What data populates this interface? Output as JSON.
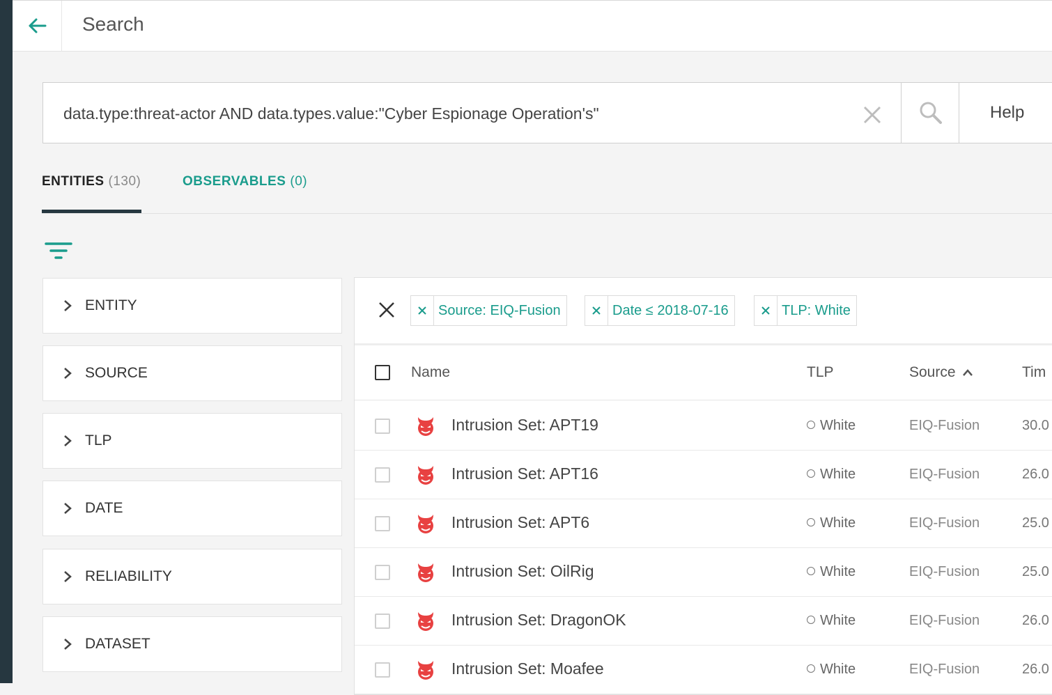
{
  "header": {
    "title": "Search"
  },
  "search": {
    "query": "data.type:threat-actor AND data.types.value:\"Cyber Espionage Operation's\"",
    "help_label": "Help"
  },
  "tabs": [
    {
      "label": "ENTITIES",
      "count": "(130)",
      "active": true
    },
    {
      "label": "OBSERVABLES",
      "count": "(0)",
      "active": false
    }
  ],
  "facets": [
    "ENTITY",
    "SOURCE",
    "TLP",
    "DATE",
    "RELIABILITY",
    "DATASET"
  ],
  "active_filters": [
    "Source: EIQ-Fusion",
    "Date ≤ 2018-07-16",
    "TLP: White"
  ],
  "table": {
    "columns": {
      "name": "Name",
      "tlp": "TLP",
      "source": "Source",
      "time": "Tim"
    },
    "sort": {
      "column": "source",
      "direction": "asc"
    },
    "rows": [
      {
        "name": "Intrusion Set: APT19",
        "tlp": "White",
        "source": "EIQ-Fusion",
        "time": "30.0"
      },
      {
        "name": "Intrusion Set: APT16",
        "tlp": "White",
        "source": "EIQ-Fusion",
        "time": "26.0"
      },
      {
        "name": "Intrusion Set: APT6",
        "tlp": "White",
        "source": "EIQ-Fusion",
        "time": "25.0"
      },
      {
        "name": "Intrusion Set: OilRig",
        "tlp": "White",
        "source": "EIQ-Fusion",
        "time": "25.0"
      },
      {
        "name": "Intrusion Set: DragonOK",
        "tlp": "White",
        "source": "EIQ-Fusion",
        "time": "26.0"
      },
      {
        "name": "Intrusion Set: Moafee",
        "tlp": "White",
        "source": "EIQ-Fusion",
        "time": "26.0"
      }
    ]
  },
  "icons": {
    "back": "arrow-left-icon",
    "clear": "close-icon",
    "search": "search-icon",
    "filter": "filter-icon",
    "facet": "chevron-right-icon",
    "row_type": "devil-icon",
    "sort": "chevron-up-icon"
  },
  "colors": {
    "accent": "#1a9c8c",
    "sidebar": "#263740",
    "threat_icon": "#e84141"
  }
}
